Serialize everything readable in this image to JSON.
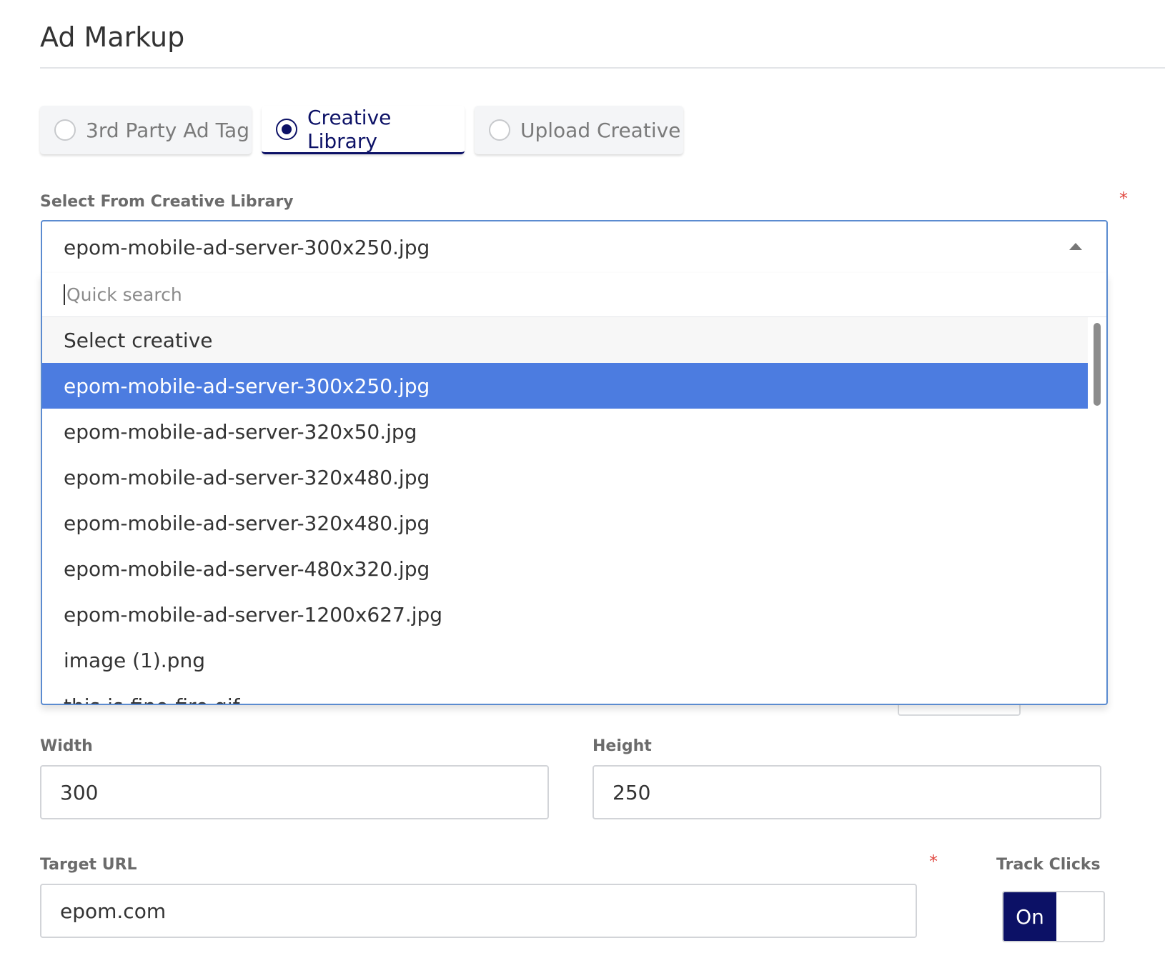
{
  "section": {
    "title": "Ad Markup"
  },
  "markup_tabs": [
    {
      "label": "3rd Party Ad Tag",
      "selected": false
    },
    {
      "label": "Creative Library",
      "selected": true
    },
    {
      "label": "Upload Creative",
      "selected": false
    }
  ],
  "creative_select": {
    "label": "Select From Creative Library",
    "required_mark": "*",
    "value": "epom-mobile-ad-server-300x250.jpg",
    "search_placeholder": "Quick search",
    "options": [
      "Select creative",
      "epom-mobile-ad-server-300x250.jpg",
      "epom-mobile-ad-server-320x50.jpg",
      "epom-mobile-ad-server-320x480.jpg",
      "epom-mobile-ad-server-320x480.jpg",
      "epom-mobile-ad-server-480x320.jpg",
      "epom-mobile-ad-server-1200x627.jpg",
      "image (1).png",
      "this-is-fine-fire.gif"
    ],
    "selected_index": 1
  },
  "width": {
    "label": "Width",
    "value": "300"
  },
  "height": {
    "label": "Height",
    "value": "250"
  },
  "target_url": {
    "label": "Target URL",
    "required_mark": "*",
    "value": "epom.com"
  },
  "track_clicks": {
    "label": "Track Clicks",
    "on_label": "On",
    "state": "on"
  },
  "colors": {
    "accent": "#0c1166",
    "selected_option": "#4c7ce0",
    "required": "#e0463e"
  }
}
